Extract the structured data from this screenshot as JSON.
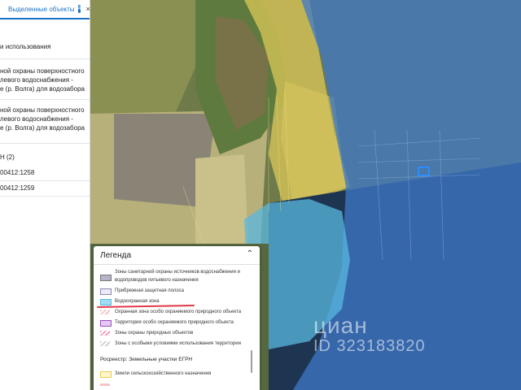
{
  "tab": {
    "label": "Выделенные объекты",
    "count": "4",
    "close": "×"
  },
  "panel": {
    "usage_label": "и использования",
    "zone1_line1": "ной охраны поверхностного",
    "zone1_line2": "левого водоснабжения -",
    "zone1_line3": "е (р. Волга) для водозабора",
    "zone2_line1": "ной охраны поверхностного",
    "zone2_line2": "левого водоснабжения -",
    "zone2_line3": "е (р. Волга) для водозабора",
    "group_label": "Н (2)",
    "parcel1": "00412:1258",
    "parcel2": "00412:1259"
  },
  "legend": {
    "title": "Легенда",
    "toggle": "⌃",
    "item1_line1": "Зоны санитарной охраны источников водоснабжения и",
    "item1_line2": "водопроводов питьевого назначения",
    "item2": "Прибрежная защитная полоса",
    "item3": "Водоохранная зона",
    "item4": "Охранная зона особо охраняемого природного объекта",
    "item5": "Территория особо охраняемого природного объекта",
    "item6": "Зоны охраны природных объектов",
    "item7": "Зоны с особыми условиями использования территории",
    "section": "Росреестр: Земельные участки ЕГРН",
    "item8": "Земли сельскохозяйственного назначения"
  },
  "watermark": {
    "logo": "циан",
    "id": "ID 323183820"
  },
  "colors": {
    "water_zone": "#5ab8e0",
    "protection_zone": "#2b6fd0",
    "accent": "#1a73c8"
  }
}
